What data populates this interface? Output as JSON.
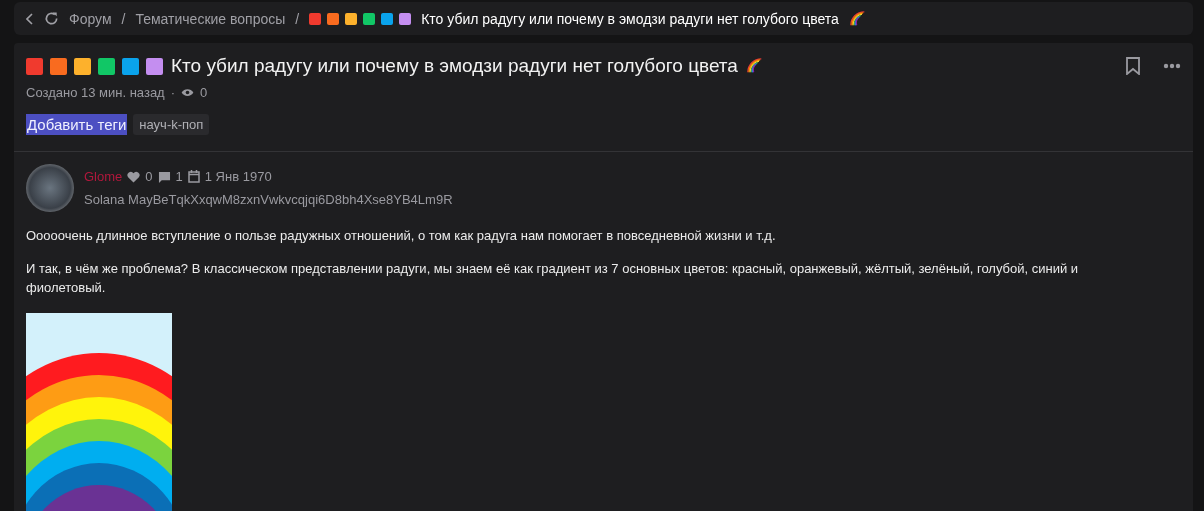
{
  "breadcrumbs": [
    {
      "label": "Форум"
    },
    {
      "label": "Тематические вопросы"
    }
  ],
  "breadcrumb_separators": [
    "/",
    "/"
  ],
  "breadcrumb_current": {
    "squares": [
      {
        "color": "#f03a2e"
      },
      {
        "color": "#f96b1f"
      },
      {
        "color": "#fdb12c"
      },
      {
        "color": "#11c766"
      },
      {
        "color": "#0aa3ec"
      },
      {
        "color": "#c48ef0"
      }
    ],
    "title": "Кто убил радугу или почему в эмодзи радуги нет голубого цвета"
  },
  "topic": {
    "squares": [
      {
        "color": "#f03a2e"
      },
      {
        "color": "#f96b1f"
      },
      {
        "color": "#fdb12c"
      },
      {
        "color": "#11c766"
      },
      {
        "color": "#0aa3ec"
      },
      {
        "color": "#c48ef0"
      }
    ],
    "title": "Кто убил радугу или почему в эмодзи радуги нет голубого цвета",
    "created": "Создано 13 мин. назад",
    "separator": "·",
    "views": "0",
    "add_tags": "Добавить теги",
    "tags": [
      "науч-k-поп"
    ]
  },
  "post": {
    "author": "Glome",
    "likes": "0",
    "comments": "1",
    "date": "1 Янв 1970",
    "signature": "Solana MayBeTqkXxqwM8zxnVwkvcqjqi6D8bh4Xse8YB4Lm9R",
    "paragraphs": [
      "Ооооочень длинное вступление о пользе радужных отношений, о том как радуга нам помогает в повседневной жизни и т.д.",
      "И так, в чём же проблема? В классическом представлении радуги, мы знаем её как градиент из 7 основных цветов: красный, оранжевый, жёлтый, зелёный, голубой, синий и фиолетовый."
    ]
  }
}
